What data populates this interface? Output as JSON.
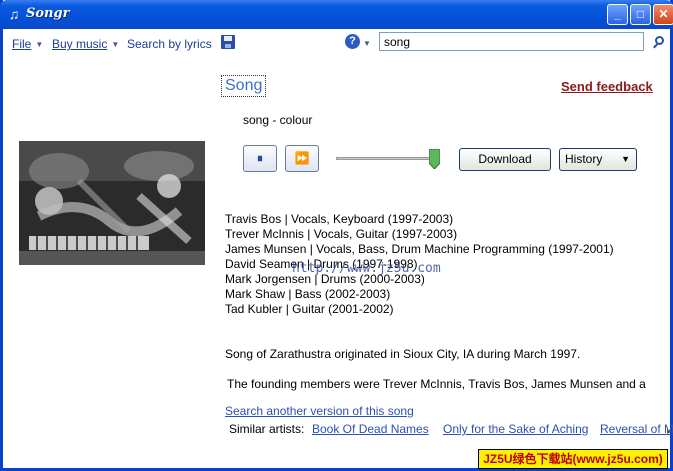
{
  "window": {
    "title": "Songr"
  },
  "menu": {
    "file_label": "File",
    "buy_music_label": "Buy music",
    "search_by_lyrics_label": "Search by lyrics"
  },
  "search": {
    "value": "song"
  },
  "song_tab": {
    "label": "Song"
  },
  "feedback_label": "Send feedback",
  "song_title": "song - colour",
  "controls": {
    "pause_symbol": "⏸",
    "forward_symbol": "⏩",
    "slider_level": 1.0,
    "download_label": "Download",
    "history_label": "History"
  },
  "members": [
    "Travis Bos | Vocals, Keyboard (1997-2003)",
    "Trever McInnis | Vocals, Guitar (1997-2003)",
    "James Munsen | Vocals, Bass, Drum Machine Programming (1997-2001)",
    "David Seamen | Drums (1997-1998)",
    "Mark Jorgensen | Drums (2000-2003)",
    "Mark Shaw | Bass (2002-2003)",
    "Tad Kubler | Guitar (2001-2002)"
  ],
  "watermark": "http://www.jz5u.com",
  "bio": {
    "line1": "Song of Zarathustra originated in Sioux City, IA during March 1997.",
    "line2": "The founding members were Trever McInnis, Travis Bos, James Munsen and a"
  },
  "search_another_label": "Search another version of this song",
  "similar": {
    "label": "Similar artists:",
    "artists": [
      "Book Of Dead Names",
      "Only for the Sake of Aching",
      "Reversal of M"
    ]
  },
  "banner": "JZ5U绿色下载站(www.jz5u.com)",
  "colors": {
    "title_bar": "#0451d8",
    "link": "#2a4fb8",
    "feedback": "#8b1a1a",
    "banner_bg": "#fff200",
    "banner_text": "#c00000"
  }
}
